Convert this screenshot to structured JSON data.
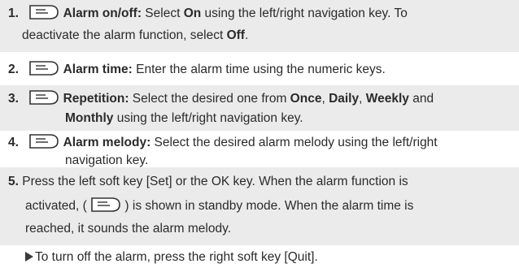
{
  "steps": [
    {
      "num": "1.",
      "title": "Alarm on/off:",
      "t1": " Select ",
      "b1": "On",
      "t2": " using the left/right navigation key. To",
      "line2a": "deactivate the alarm function, select ",
      "line2b": "Off",
      "line2c": "."
    },
    {
      "num": "2.",
      "title": "Alarm time:",
      "t1": " Enter the alarm time using the numeric keys."
    },
    {
      "num": "3.",
      "title": "Repetition:",
      "t1": " Select the desired one from ",
      "o1": "Once",
      "c1": ", ",
      "o2": "Daily",
      "c2": ", ",
      "o3": "Weekly",
      "and": " and",
      "o4": "Monthly",
      "t2": " using the left/right navigation key."
    },
    {
      "num": "4.",
      "title": "Alarm melody:",
      "t1": " Select the desired alarm melody using the left/right",
      "line2": "navigation key."
    },
    {
      "num": "5.",
      "line1": " Press the left soft key [Set] or the OK key. When the alarm function is",
      "line2a": "activated, ( ",
      "line2b": " ) is shown in standby mode. When the alarm time is",
      "line3": "reached, it sounds the alarm melody."
    }
  ],
  "note": "To turn off the alarm, press the right soft key [Quit].",
  "colors": {
    "shade": "#ebebeb",
    "text": "#2b2b2b"
  },
  "icons": {
    "soft_key": "soft-key-icon",
    "note": "arrow-right-icon"
  }
}
